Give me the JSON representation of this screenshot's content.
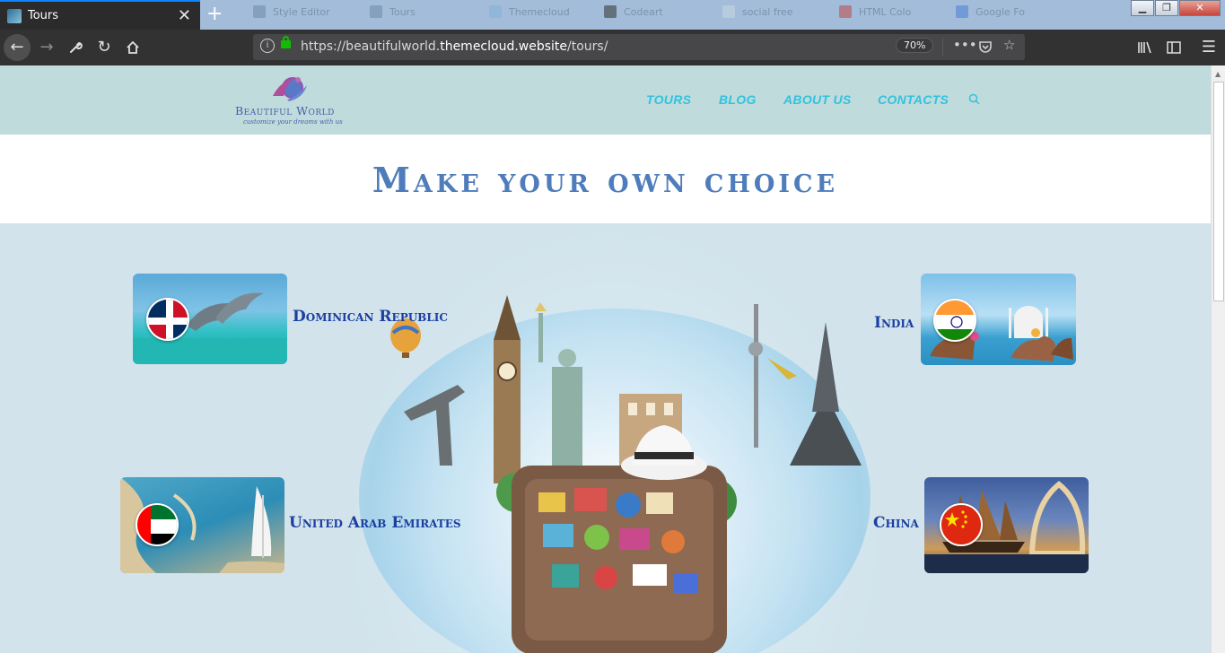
{
  "browser": {
    "active_tab": {
      "title": "Tours"
    },
    "background_tabs": [
      "Style Editor",
      "Tours",
      "Themecloud",
      "Codeart",
      "social free",
      "HTML Colo",
      "Google Fo"
    ],
    "url": {
      "prefix": "https://beautifulworld.",
      "host": "themecloud.website",
      "path": "/tours/"
    },
    "zoom": "70%"
  },
  "site": {
    "logo": {
      "name": "Beautiful World",
      "tagline": "customize your dreams with us"
    },
    "menu": [
      "TOURS",
      "BLOG",
      "ABOUT US",
      "CONTACTS"
    ],
    "headline": "Make your own choice",
    "destinations": [
      {
        "name": "Dominican Republic",
        "flag": "dominican-republic-flag"
      },
      {
        "name": "India",
        "flag": "india-flag"
      },
      {
        "name": "United Arab Emirates",
        "flag": "uae-flag"
      },
      {
        "name": "China",
        "flag": "china-flag"
      }
    ]
  },
  "colors": {
    "header_bg": "#bfdbdb",
    "menu": "#33c2de",
    "headline": "#4f7dbb",
    "destination": "#1a3fa2"
  }
}
